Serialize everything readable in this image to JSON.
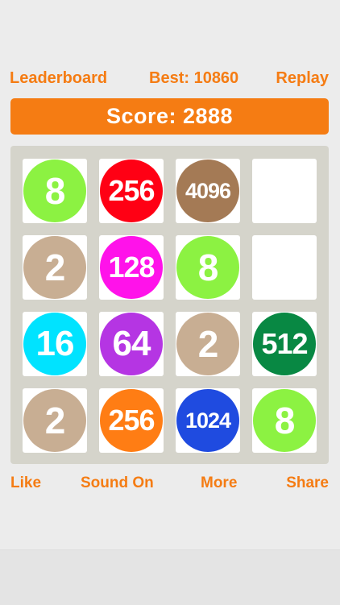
{
  "header": {
    "leaderboard_label": "Leaderboard",
    "best_label": "Best: 10860",
    "replay_label": "Replay"
  },
  "score": {
    "label": "Score: 2888"
  },
  "board": {
    "cells": [
      [
        {
          "value": "8",
          "color": "#8cf242"
        },
        {
          "value": "256",
          "color": "#ff0014"
        },
        {
          "value": "4096",
          "color": "#a47a55"
        },
        {
          "value": "",
          "color": ""
        }
      ],
      [
        {
          "value": "2",
          "color": "#c8ae93"
        },
        {
          "value": "128",
          "color": "#ff12ea"
        },
        {
          "value": "8",
          "color": "#8cf242"
        },
        {
          "value": "",
          "color": ""
        }
      ],
      [
        {
          "value": "16",
          "color": "#00e3ff"
        },
        {
          "value": "64",
          "color": "#b535e3"
        },
        {
          "value": "2",
          "color": "#c8ae93"
        },
        {
          "value": "512",
          "color": "#088843"
        }
      ],
      [
        {
          "value": "2",
          "color": "#c8ae93"
        },
        {
          "value": "256",
          "color": "#ff7d14"
        },
        {
          "value": "1024",
          "color": "#1f4be0"
        },
        {
          "value": "8",
          "color": "#8cf242"
        }
      ]
    ]
  },
  "footer": {
    "like_label": "Like",
    "sound_label": "Sound On",
    "more_label": "More",
    "share_label": "Share"
  }
}
